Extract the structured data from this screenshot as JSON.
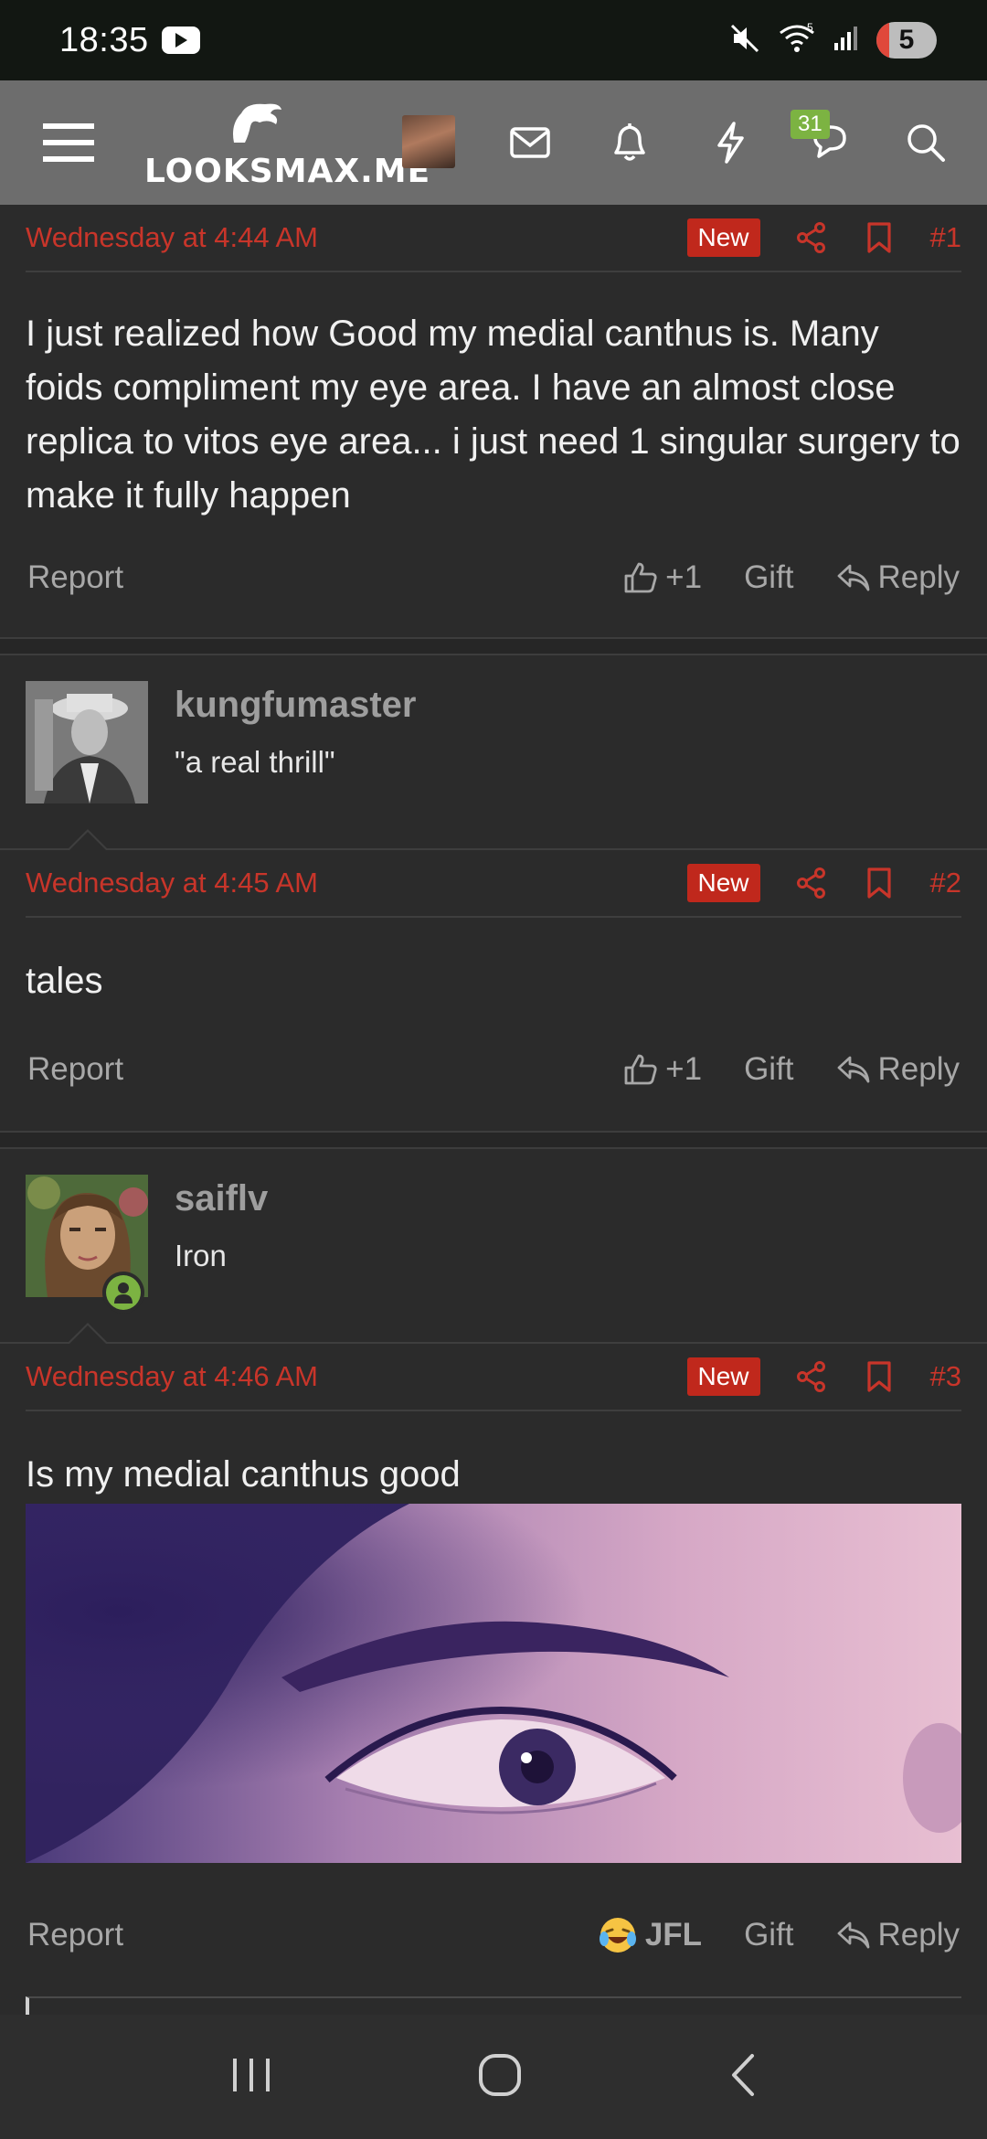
{
  "status_bar": {
    "time": "18:35",
    "battery_level": "5",
    "wifi_label": "5"
  },
  "nav": {
    "logo_text": "LOOKSMAX.ME",
    "chat_badge": "31",
    "icons": [
      "menu-icon",
      "mail-icon",
      "bell-icon",
      "lightning-icon",
      "chat-icon",
      "search-icon"
    ]
  },
  "posts": [
    {
      "date": "Wednesday at 4:44 AM",
      "badge": "New",
      "number": "#1",
      "text": "I just realized how Good my medial canthus is. Many foids compliment my eye area. I have an almost close replica to vitos eye area... i just need 1 singular surgery to make it fully happen",
      "report": "Report",
      "reaction": "+1",
      "gift": "Gift",
      "reply": "Reply"
    },
    {
      "author": "kungfumaster",
      "author_title": "\"a real thrill\"",
      "date": "Wednesday at 4:45 AM",
      "badge": "New",
      "number": "#2",
      "text": "tales",
      "report": "Report",
      "reaction": "+1",
      "gift": "Gift",
      "reply": "Reply"
    },
    {
      "author": "saiflv",
      "author_title": "Iron",
      "date": "Wednesday at 4:46 AM",
      "badge": "New",
      "number": "#3",
      "text": "Is my medial canthus good",
      "report": "Report",
      "reaction": "JFL",
      "gift": "Gift",
      "reply": "Reply"
    }
  ],
  "colors": {
    "accent_red": "#c8352a",
    "badge_red": "#c0281c",
    "online_green": "#7cb342",
    "nav_bg": "#6d6d6d",
    "page_bg": "#2b2b2b"
  }
}
